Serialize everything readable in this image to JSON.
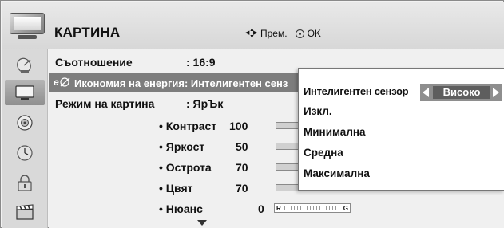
{
  "header": {
    "title": "КАРТИНА",
    "nav_hint": "Прем.",
    "ok_label": "OK"
  },
  "sidebar": {
    "items": [
      {
        "icon": "satellite-dish-icon",
        "active": false
      },
      {
        "icon": "tv-icon",
        "active": true
      },
      {
        "icon": "speaker-icon",
        "active": false
      },
      {
        "icon": "clock-icon",
        "active": false
      },
      {
        "icon": "lock-icon",
        "active": false
      },
      {
        "icon": "clapperboard-icon",
        "active": false
      }
    ]
  },
  "menu": {
    "aspect_label": "Съотношение",
    "aspect_value": ": 16:9",
    "energy_label": "Икономия на енергия: Интелигентен сенз",
    "mode_label": "Режим на картина",
    "mode_value": ": ЯрЪк",
    "sliders": [
      {
        "label": "• Контраст",
        "value": "100",
        "level": 1.0
      },
      {
        "label": "• Яркост",
        "value": "50",
        "level": 0.5
      },
      {
        "label": "• Острота",
        "value": "70",
        "level": 0.7
      },
      {
        "label": "• Цвят",
        "value": "70",
        "level": 0.7
      }
    ],
    "tint": {
      "label": "• Нюанс",
      "value": "0",
      "left": "R",
      "right": "G"
    }
  },
  "popup": {
    "options": [
      "Интелигентен сензор",
      "Изкл.",
      "Минимална",
      "Средна",
      "Максимална"
    ],
    "selector_value": "Високо"
  },
  "colors": {
    "highlight": "#7d7d7d",
    "selector": "#8e8e8e",
    "background": "#f0f0f0"
  }
}
